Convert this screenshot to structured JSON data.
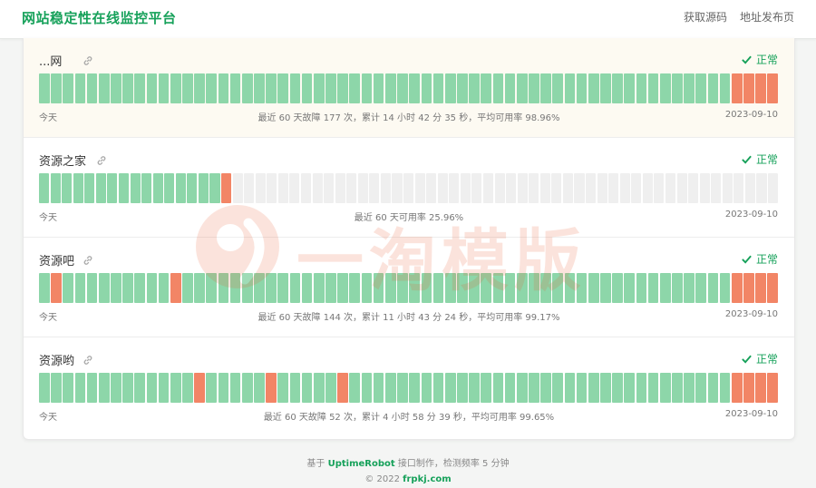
{
  "header": {
    "title": "网站稳定性在线监控平台",
    "nav": [
      "获取源码",
      "地址发布页"
    ]
  },
  "status_colors": {
    "ok": "#8dd6a9",
    "down": "#f28566",
    "no_data": "#efefef",
    "accent": "#16a15a"
  },
  "monitors": [
    {
      "name": "...网",
      "status": "正常",
      "start_label": "今天",
      "summary": "最近 60 天故障 177 次，累计 14 小时 42 分 35 秒，平均可用率 98.96%",
      "end_date": "2023-09-10",
      "days": "ggggggggggggggggggggggggggggggggggggggggggggggggggggggggggbbbb"
    },
    {
      "name": "资源之家",
      "status": "正常",
      "start_label": "今天",
      "summary": "最近 60 天可用率 25.96%",
      "end_date": "2023-09-10",
      "days": "ggggggggggggggggbnnnnnnnnnnnnnnnnnnnnnnnnnnnnnnnnnnnnnnnnnnnnnnnn"
    },
    {
      "name": "资源吧",
      "status": "正常",
      "start_label": "今天",
      "summary": "最近 60 天故障 144 次，累计 11 小时 43 分 24 秒，平均可用率 99.17%",
      "end_date": "2023-09-10",
      "days": "gbgggggggggbggggggggggggggggggggggggggggggggggggggggggggggbbbb"
    },
    {
      "name": "资源哟",
      "status": "正常",
      "start_label": "今天",
      "summary": "最近 60 天故障 52 次，累计 4 小时 58 分 39 秒，平均可用率 99.65%",
      "end_date": "2023-09-10",
      "days": "gggggggggggggbgggggbgggggbggggggggggggggggggggggggggggggggbbbb"
    }
  ],
  "watermark": {
    "text": "一淘模版"
  },
  "footer": {
    "line1_prefix": "基于",
    "line1_brand": "UptimeRobot",
    "line1_suffix": "接口制作，检测频率 5 分钟",
    "line2_prefix": "© 2022",
    "line2_domain": "frpkj.com"
  }
}
